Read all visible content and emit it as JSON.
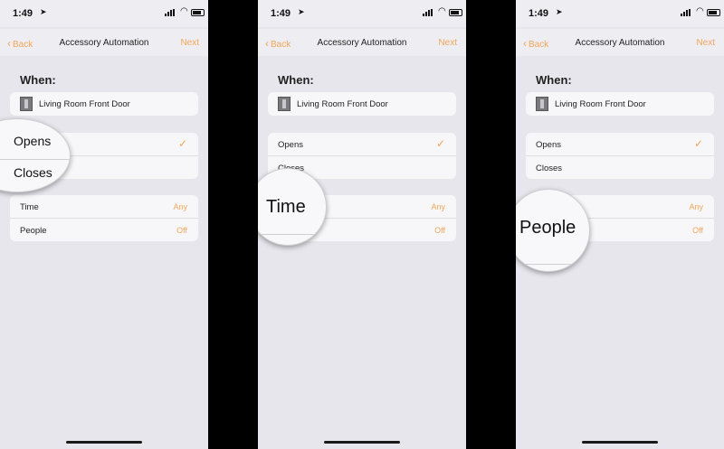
{
  "status": {
    "time": "1:49"
  },
  "nav": {
    "back_label": "Back",
    "title": "Accessory Automation",
    "next_label": "Next"
  },
  "when_label": "When:",
  "device": {
    "name": "Living Room Front Door"
  },
  "events": [
    {
      "label": "Opens",
      "checked": true
    },
    {
      "label": "Closes",
      "checked": false
    }
  ],
  "conditions": [
    {
      "label": "Time",
      "value": "Any"
    },
    {
      "label": "People",
      "value": "Off"
    }
  ],
  "magnifiers": {
    "panel1": [
      "Opens",
      "Closes"
    ],
    "panel2": "Time",
    "panel3": "People"
  },
  "colors": {
    "accent": "#f2a65a",
    "background": "#e7e6ec",
    "card": "#f7f7f9"
  }
}
